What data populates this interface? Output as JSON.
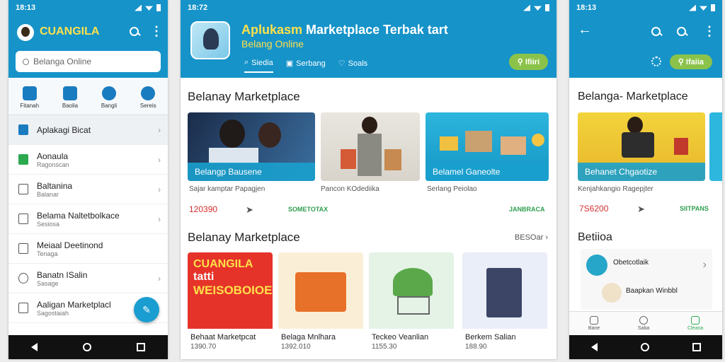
{
  "phone1": {
    "status_time": "18:13",
    "app_title": "CUANGILA",
    "search_placeholder": "Belanga Online",
    "shortcuts": [
      {
        "label": "Fitanah",
        "icon": "grid-icon"
      },
      {
        "label": "Baolia",
        "icon": "cart-icon"
      },
      {
        "label": "Bangli",
        "icon": "check-icon"
      },
      {
        "label": "Sereis",
        "icon": "chat-icon"
      }
    ],
    "menu": [
      {
        "title": "Aplakagi Bicat",
        "sub": "",
        "icon": "bag-icon"
      },
      {
        "title": "Aonaula",
        "sub": "Ragonscan",
        "icon": "store-icon"
      },
      {
        "title": "Baltanina",
        "sub": "Balanar",
        "icon": "doc-icon"
      },
      {
        "title": "Belama Naltetbolkace",
        "sub": "Sesiosa",
        "icon": "box-icon"
      },
      {
        "title": "Meiaal Deetinond",
        "sub": "Tenaga",
        "icon": "music-icon"
      },
      {
        "title": "Banatn ISalin",
        "sub": "Sasage",
        "icon": "clock-icon"
      },
      {
        "title": "Aaligan Marketplacl",
        "sub": "Sagostaiah",
        "icon": "home-icon"
      }
    ]
  },
  "phone2": {
    "status_time": "18:72",
    "app_title_a": "Aplukasm",
    "app_title_b": "Marketplace Terbak tart",
    "app_subtitle": "Belang Online",
    "tabs": [
      "Siedia",
      "Serbang",
      "Soals"
    ],
    "filter_label": "Ifiiri",
    "section1_title": "Belanay Marketplace",
    "cards": [
      {
        "caption": "Belangp Bausene",
        "desc": "Sajar kamptar Papagjen",
        "price": "120390",
        "tag": "SOMETOTAX"
      },
      {
        "caption": "",
        "desc": "Pancon KOdediika",
        "price": "",
        "tag": ""
      },
      {
        "caption": "Belamel Ganeolte",
        "desc": "Serlang Peiolao",
        "price": "",
        "tag": "JANBRACA"
      }
    ],
    "section2_title": "Belanay Marketplace",
    "section2_more": "BESOar",
    "products": [
      {
        "name": "Behaat Marketpcat",
        "price": "1390.70",
        "banner_top": "CUANGILA",
        "banner_mid": "tatti",
        "banner_bot": "WEISOBOIOE"
      },
      {
        "name": "Belaga Mnlhara",
        "price": "1392.010"
      },
      {
        "name": "Teckeo Veanlian",
        "price": "1155.30"
      },
      {
        "name": "Berkem Salian",
        "price": "188.90"
      }
    ]
  },
  "phone3": {
    "status_time": "18:13",
    "filter_label": "Ifaiia",
    "section1_title": "Belanga- Marketplace",
    "card_caption": "Behanet Chgaotize",
    "card_desc": "Kenjahkangio Ragepjter",
    "price": "7S6200",
    "tag": "SIITPANS",
    "section2_title": "Betiioa",
    "list": [
      {
        "title": "Obetcotlaik"
      },
      {
        "title": "Baapkan Winbbl"
      }
    ],
    "bottom_nav": [
      "Bane",
      "Saba",
      "Cleana"
    ]
  },
  "colors": {
    "primary": "#1693c9",
    "accent": "#ffe14a",
    "green": "#8bc34a",
    "price_red": "#d32f2f"
  }
}
